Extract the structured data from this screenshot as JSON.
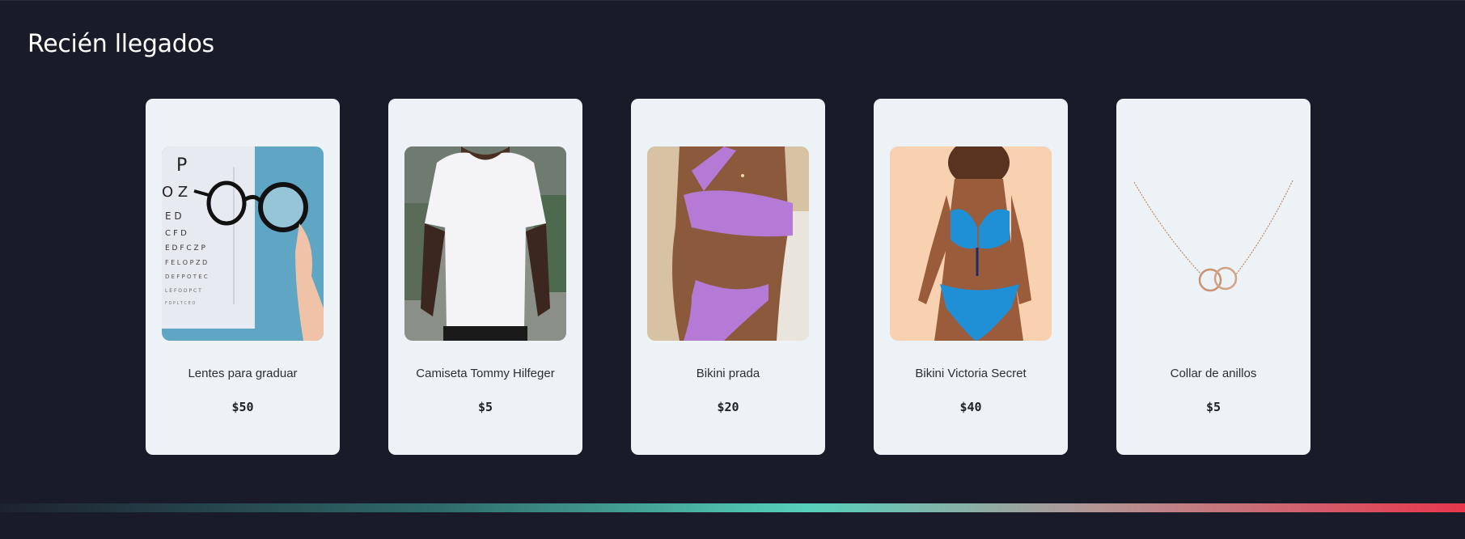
{
  "section": {
    "title": "Recién llegados"
  },
  "products": [
    {
      "name": "Lentes para graduar",
      "price": "$50",
      "image": "glasses-eye-chart"
    },
    {
      "name": "Camiseta Tommy Hilfeger",
      "price": "$5",
      "image": "white-tshirt"
    },
    {
      "name": "Bikini prada",
      "price": "$20",
      "image": "purple-bikini"
    },
    {
      "name": "Bikini Victoria Secret",
      "price": "$40",
      "image": "blue-bikini"
    },
    {
      "name": "Collar de anillos",
      "price": "$5",
      "image": "ring-necklace"
    }
  ],
  "colors": {
    "background": "#191b28",
    "card": "#ecf2f5",
    "accent_teal": "#55d0bb",
    "accent_red": "#e8364c"
  }
}
